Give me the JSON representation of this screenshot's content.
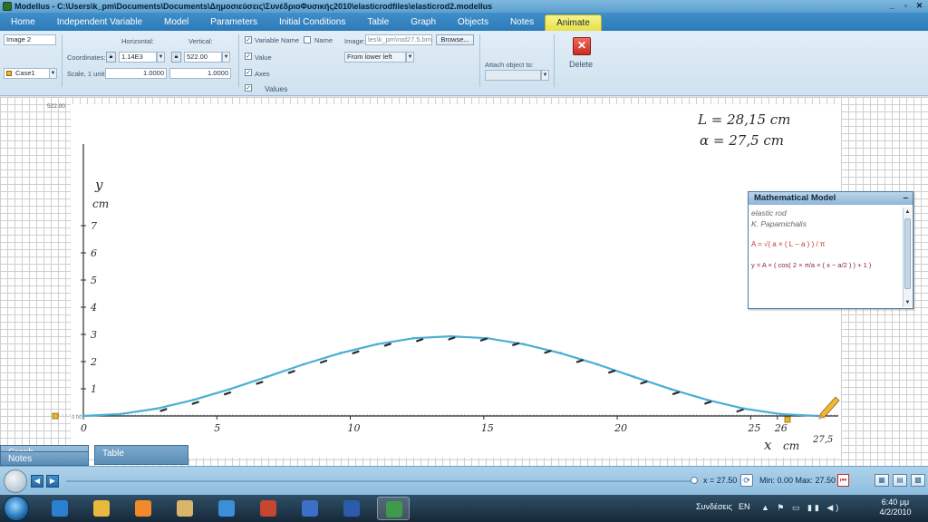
{
  "window": {
    "title": "Modellus - C:\\Users\\k_pm\\Documents\\Documents\\Δημοσιεύσεις\\ΣυνέδριοΦυσικής2010\\elasticrodfiles\\elasticrod2.modellus",
    "controls": [
      "_",
      "▫",
      "✕"
    ]
  },
  "menu": {
    "items": [
      "Home",
      "Independent Variable",
      "Model",
      "Parameters",
      "Initial Conditions",
      "Table",
      "Graph",
      "Objects",
      "Notes",
      "Animate"
    ],
    "active": "Animate"
  },
  "ribbon": {
    "object_name": "Image 2",
    "case_name": "Case1",
    "case_color": "#f0b429",
    "horizontal_label": "Horizontal:",
    "vertical_label": "Vertical:",
    "coordinates_label": "Coordinates:",
    "horizontal_value": "1.14E3",
    "vertical_value": "522.00",
    "scale_label": "Scale, 1 unit =",
    "scale_h": "1.0000",
    "scale_v": "1.0000",
    "chk_variable_name": "Variable Name",
    "chk_name": "Name",
    "chk_value": "Value",
    "chk_axes": "Axes",
    "image_label": "Image:",
    "image_path": "les\\k_pm\\rod27.5.bmp",
    "browse_label": "Browse...",
    "origin_option": "From lower left",
    "attach_label": "Attach object to:",
    "attach_value": "",
    "group_values_label": "Values",
    "delete_label": "Delete",
    "delete_glyph": "✕"
  },
  "workspace": {
    "y_max_label": "522.00",
    "origin_small_label": "0.00",
    "handwritten": {
      "L_note": "L = 28,15 cm",
      "a_note": "α = 27,5 cm",
      "y_label": "y",
      "y_unit": "cm",
      "x_label": "x",
      "x_unit": "cm",
      "x_end_label": "27,5"
    }
  },
  "chart_data": {
    "type": "line",
    "x_ticks": [
      0,
      5,
      10,
      15,
      20,
      25,
      26
    ],
    "y_ticks": [
      1,
      2,
      3,
      4,
      5,
      6,
      7
    ],
    "xlim": [
      0,
      28
    ],
    "ylim": [
      0,
      10
    ],
    "xlabel": "x cm",
    "ylabel": "y cm",
    "series": [
      {
        "color": "#4aaed6",
        "x": [
          0,
          1.375,
          2.75,
          4.125,
          5.5,
          6.875,
          8.25,
          9.625,
          11,
          12.375,
          13.75,
          15.125,
          16.5,
          17.875,
          19.25,
          20.625,
          22,
          23.375,
          24.75,
          26.125,
          27.5
        ],
        "y": [
          0,
          0.069,
          0.27,
          0.59,
          0.99,
          1.44,
          1.9,
          2.31,
          2.64,
          2.86,
          2.93,
          2.86,
          2.64,
          2.31,
          1.9,
          1.44,
          0.99,
          0.59,
          0.27,
          0.069,
          0
        ]
      },
      {
        "color": "#2b2b2b",
        "x": [
          3,
          4.2,
          5.4,
          6.6,
          7.8,
          9,
          10.2,
          11.4,
          12.6,
          13.8,
          15,
          16.2,
          17.4,
          18.6,
          19.8,
          21,
          22.2,
          23.4,
          24.6
        ],
        "y": [
          0.32,
          0.58,
          0.93,
          1.32,
          1.72,
          2.1,
          2.44,
          2.72,
          2.89,
          2.95,
          2.91,
          2.74,
          2.46,
          2.12,
          1.73,
          1.33,
          0.94,
          0.59,
          0.3
        ]
      }
    ]
  },
  "math_model": {
    "title": "Mathematical Model",
    "close_glyph": "–",
    "line1": "elastic rod",
    "line2": "K. Papamichalis",
    "eq1": "A = √( a × ( L − a ) ) / π",
    "eq2": "y = A × ( cos( 2 × π/a × ( x − a/2 ) ) + 1 )"
  },
  "panels": {
    "graph_tab": "Graph",
    "notes_tab": "Notes",
    "table_tab": "Table"
  },
  "animation": {
    "x_readout": "x  = 27.50",
    "min_max": "Min: 0.00  Max: 27.50",
    "prev_glyph": "◀",
    "next_glyph": "▶",
    "refresh_glyph": "⟳",
    "stop_glyph": "⏮"
  },
  "taskbar": {
    "lang_label": "Συνδέσεις",
    "lang": "EN",
    "tray": "▲ ⚑ ▭ ▮▮ ◀)",
    "time": "6:40 μμ",
    "date": "4/2/2010",
    "apps": [
      {
        "name": "ie",
        "color": "#2b7fd1"
      },
      {
        "name": "explorer",
        "color": "#e7b93f"
      },
      {
        "name": "media",
        "color": "#f08a2a"
      },
      {
        "name": "folder",
        "color": "#d9b56a"
      },
      {
        "name": "sync",
        "color": "#3a8fd8"
      },
      {
        "name": "tools",
        "color": "#c8452f"
      },
      {
        "name": "globe",
        "color": "#3b6fc8"
      },
      {
        "name": "word",
        "color": "#2a5caa"
      },
      {
        "name": "modellus",
        "color": "#3e9b4b"
      }
    ]
  }
}
